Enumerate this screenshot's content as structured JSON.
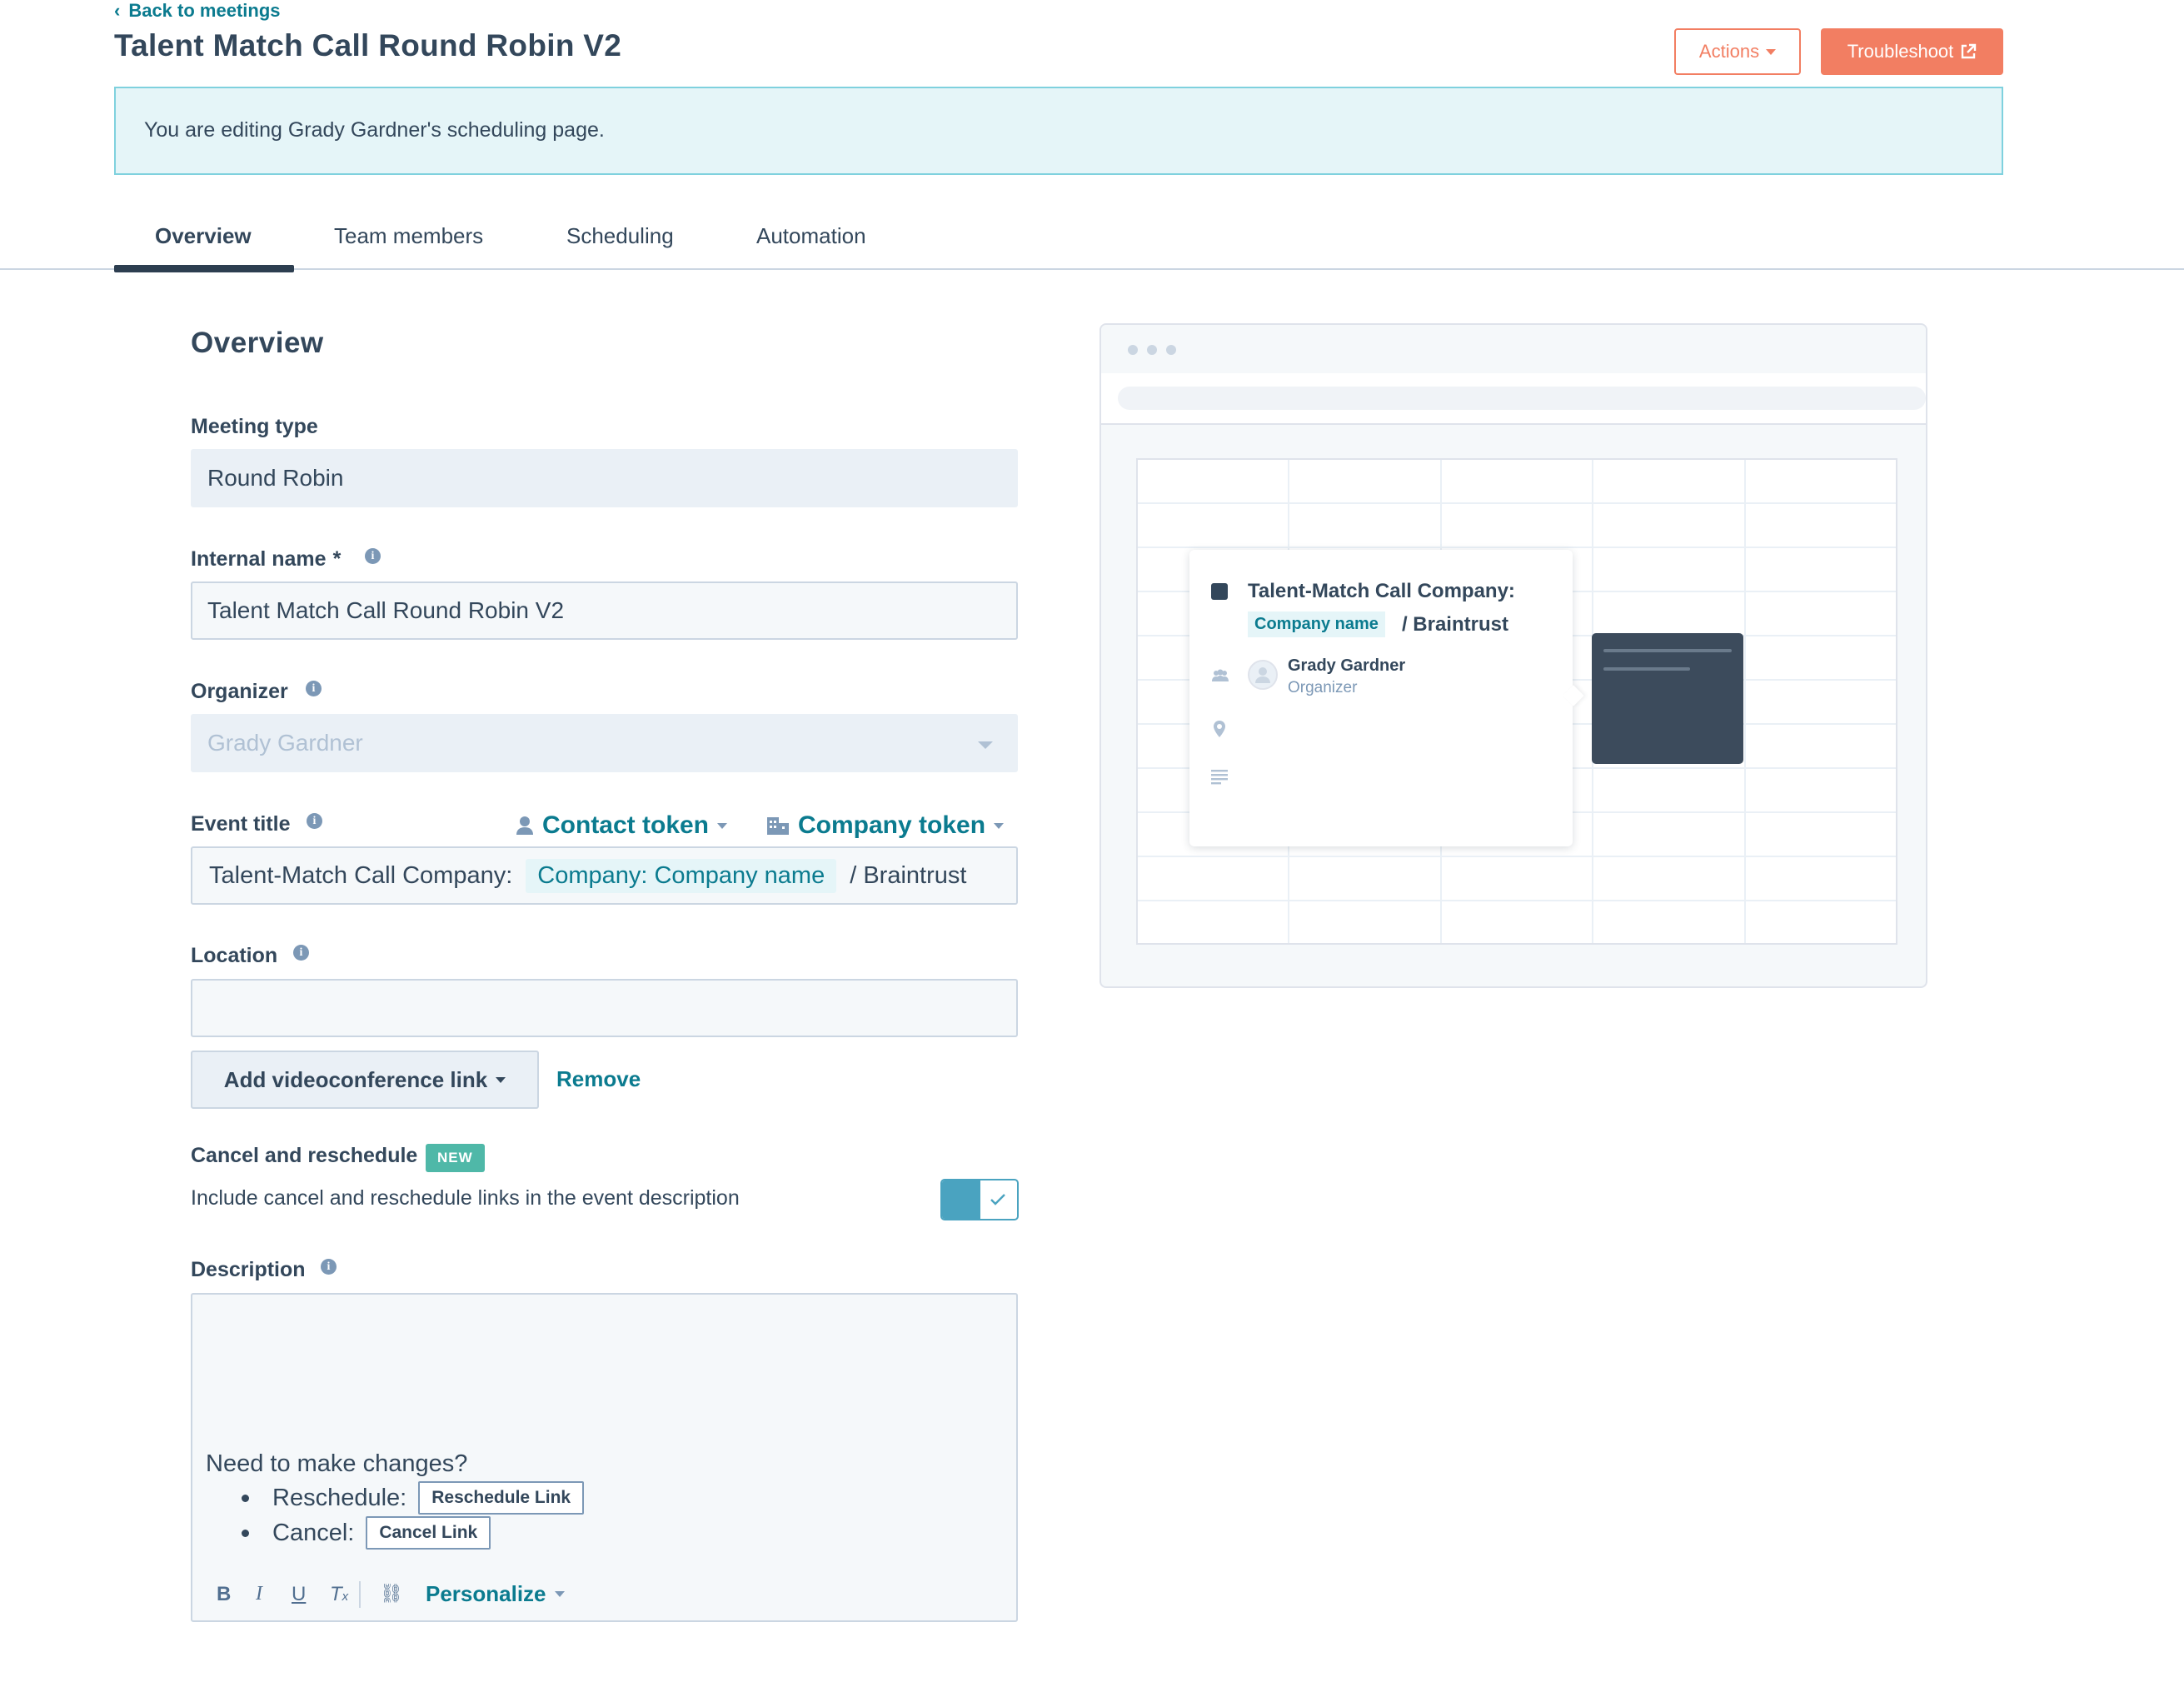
{
  "header": {
    "back_label": "Back to meetings",
    "title": "Talent Match Call Round Robin V2",
    "actions_label": "Actions",
    "troubleshoot_label": "Troubleshoot"
  },
  "banner": {
    "text": "You are editing Grady Gardner's scheduling page."
  },
  "tabs": [
    {
      "label": "Overview",
      "active": true
    },
    {
      "label": "Team members",
      "active": false
    },
    {
      "label": "Scheduling",
      "active": false
    },
    {
      "label": "Automation",
      "active": false
    }
  ],
  "form": {
    "section_title": "Overview",
    "meeting_type": {
      "label": "Meeting type",
      "value": "Round Robin"
    },
    "internal_name": {
      "label": "Internal name",
      "required_mark": "*",
      "value": "Talent Match Call Round Robin V2"
    },
    "organizer": {
      "label": "Organizer",
      "value": "Grady Gardner"
    },
    "event_title": {
      "label": "Event title",
      "contact_token": "Contact token",
      "company_token": "Company token",
      "prefix": "Talent-Match Call Company:",
      "token": "Company: Company name",
      "suffix": "/ Braintrust"
    },
    "location": {
      "label": "Location",
      "value": ""
    },
    "add_video_label": "Add videoconference link",
    "remove_label": "Remove",
    "cancel_reschedule": {
      "label": "Cancel and reschedule",
      "badge": "NEW",
      "description": "Include cancel and reschedule links in the event description",
      "enabled": true
    },
    "description": {
      "label": "Description",
      "heading": "Need to make changes?",
      "items": [
        {
          "label": "Reschedule:",
          "chip": "Reschedule Link"
        },
        {
          "label": "Cancel:",
          "chip": "Cancel Link"
        }
      ],
      "toolbar": {
        "bold": "B",
        "italic": "I",
        "underline": "U",
        "clear": "T",
        "clear_sub": "x",
        "link": "⛓",
        "personalize": "Personalize"
      }
    }
  },
  "preview": {
    "event_title_line1": "Talent-Match Call Company:",
    "token": "Company name",
    "suffix": "/ Braintrust",
    "organizer_name": "Grady Gardner",
    "organizer_role": "Organizer"
  },
  "colors": {
    "accent": "#0b7b8f",
    "primary_button": "#f27e62",
    "banner_bg": "#e5f5f8",
    "text": "#33475b"
  }
}
